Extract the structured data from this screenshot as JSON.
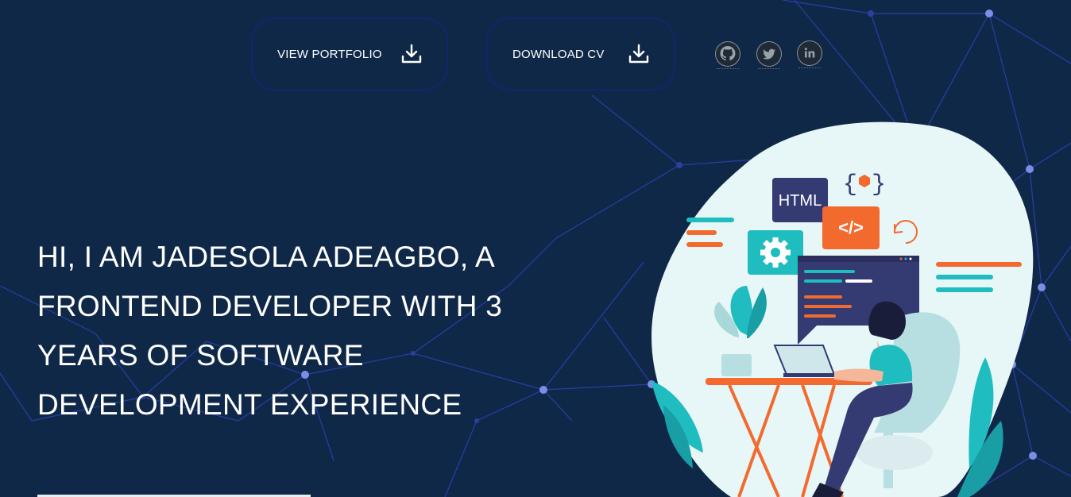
{
  "header": {
    "buttons": [
      {
        "label": "VIEW PORTFOLIO",
        "icon": "download-icon"
      },
      {
        "label": "DOWNLOAD CV",
        "icon": "download-icon"
      }
    ],
    "social": [
      {
        "name": "github",
        "icon": "github-icon"
      },
      {
        "name": "twitter",
        "icon": "twitter-icon"
      },
      {
        "name": "linkedin",
        "icon": "linkedin-icon"
      }
    ]
  },
  "hero": {
    "line1": "HI, I AM JADESOLA ADEAGBO, A",
    "line2": "FRONTEND DEVELOPER WITH 3",
    "line3": "YEARS OF SOFTWARE",
    "line4": "DEVELOPMENT EXPERIENCE"
  },
  "illustration": {
    "html_badge": "HTML",
    "code_badge": "</>",
    "braces": "{ }"
  },
  "colors": {
    "background": "#102848",
    "network": "#2f45c8",
    "blob": "#e7f6f7",
    "teal": "#1fbcc0",
    "orange": "#f26a2e",
    "navy_panel": "#343a72"
  }
}
